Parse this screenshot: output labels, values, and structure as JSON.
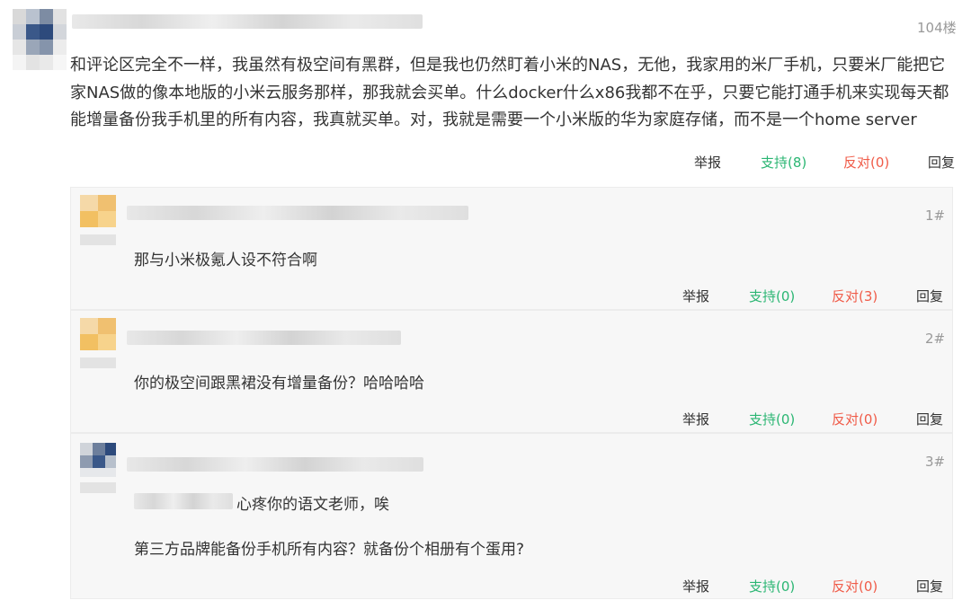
{
  "post": {
    "floor": "104楼",
    "content": "和评论区完全不一样，我虽然有极空间有黑群，但是我也仍然盯着小米的NAS，无他，我家用的米厂手机，只要米厂能把它家NAS做的像本地版的小米云服务那样，那我就会买单。什么docker什么x86我都不在乎，只要它能打通手机来实现每天都能增量备份我手机里的所有内容，我真就买单。对，我就是需要一个小米版的华为家庭存储，而不是一个home server",
    "actions": {
      "report": "举报",
      "support": "支持(8)",
      "against": "反对(0)",
      "reply": "回复"
    }
  },
  "replies": [
    {
      "floor": "1#",
      "text": "那与小米极氪人设不符合啊",
      "actions": {
        "report": "举报",
        "support": "支持(0)",
        "against": "反对(3)",
        "reply": "回复"
      }
    },
    {
      "floor": "2#",
      "text": "你的极空间跟黑裙没有增量备份？哈哈哈哈",
      "actions": {
        "report": "举报",
        "support": "支持(0)",
        "against": "反对(0)",
        "reply": "回复"
      }
    },
    {
      "floor": "3#",
      "quote_tail": "心疼你的语文老师，唉",
      "text": "第三方品牌能备份手机所有内容？就备份个相册有个蛋用?",
      "actions": {
        "report": "举报",
        "support": "支持(0)",
        "against": "反对(0)",
        "reply": "回复"
      }
    }
  ],
  "colors": {
    "support": "#2bb673",
    "against": "#f05b48",
    "reply_bg": "#f7f7f7"
  }
}
